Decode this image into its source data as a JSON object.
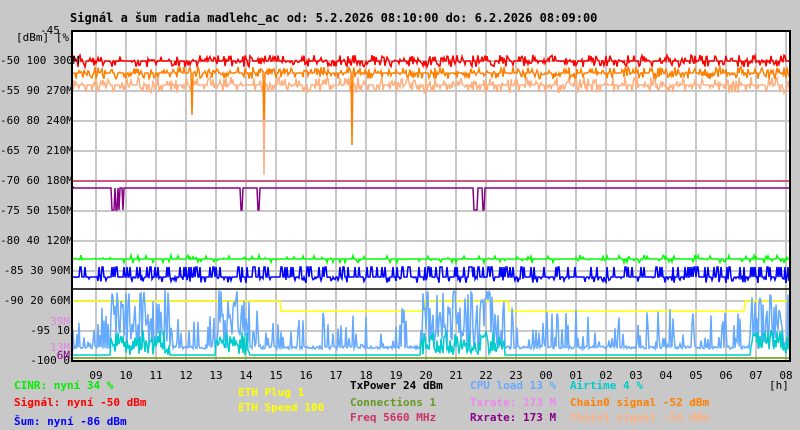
{
  "title": "Signál a šum radia madlehc_ac od: 5.2.2026 08:10:00 do: 6.2.2026 08:09:00",
  "chart_data": {
    "type": "line",
    "title": "Signál a šum radia madlehc_ac od: 5.2.2026 08:10:00 do: 6.2.2026 08:09:00",
    "xlabel": "[h]",
    "ylabel_units": "[dBm] [%]",
    "ylim_dbm": [
      -100,
      -45
    ],
    "ylim_pct": [
      0,
      100
    ],
    "ylim_rate_M": [
      0,
      300
    ],
    "grid": true,
    "y_ticks": [
      {
        "dbm": "-45",
        "pct": "",
        "rate": ""
      },
      {
        "dbm": "-50",
        "pct": "100",
        "rate": "300M"
      },
      {
        "dbm": "-55",
        "pct": "90",
        "rate": "270M"
      },
      {
        "dbm": "-60",
        "pct": "80",
        "rate": "240M"
      },
      {
        "dbm": "-65",
        "pct": "70",
        "rate": "210M"
      },
      {
        "dbm": "-70",
        "pct": "60",
        "rate": "180M"
      },
      {
        "dbm": "-75",
        "pct": "50",
        "rate": "150M"
      },
      {
        "dbm": "-80",
        "pct": "40",
        "rate": "120M"
      },
      {
        "dbm": "-85",
        "pct": "30",
        "rate": "90M"
      },
      {
        "dbm": "-90",
        "pct": "20",
        "rate": "60M"
      },
      {
        "dbm": "-95",
        "pct": "10",
        "rate": ""
      },
      {
        "dbm": "-100",
        "pct": "0",
        "rate": ""
      }
    ],
    "extra_rate_ticks": [
      {
        "label": "39M",
        "value": 39,
        "color": "#dd88dd"
      },
      {
        "label": "13M",
        "value": 13,
        "color": "#dd88dd"
      },
      {
        "label": "6M",
        "value": 6,
        "color": "#880088"
      }
    ],
    "x_ticks": [
      "09",
      "10",
      "11",
      "12",
      "13",
      "14",
      "15",
      "16",
      "17",
      "18",
      "19",
      "20",
      "21",
      "22",
      "23",
      "00",
      "01",
      "02",
      "03",
      "04",
      "05",
      "06",
      "07",
      "08"
    ],
    "series": [
      {
        "name": "Signál",
        "scale": "dbm",
        "level": -50,
        "color": "#ff0000"
      },
      {
        "name": "Chain0 signal",
        "scale": "dbm",
        "level": -52,
        "color": "#ff8000"
      },
      {
        "name": "Chain1 signal",
        "scale": "dbm",
        "level": -54,
        "color": "#ffb080"
      },
      {
        "name": "Šum",
        "scale": "dbm",
        "level": -86,
        "color": "#0000ff"
      },
      {
        "name": "CINR",
        "scale": "pct",
        "level": 34,
        "color": "#00ff00"
      },
      {
        "name": "TxPower",
        "scale": "pct",
        "level": 24,
        "color": "#000000"
      },
      {
        "name": "Rxrate",
        "scale": "rate",
        "level": 173,
        "color": "#880088"
      },
      {
        "name": "Freq",
        "scale": "rate",
        "level": 180,
        "color": "#cc3366"
      },
      {
        "name": "ETH Speed",
        "scale": "rate",
        "level": 60,
        "level_low": 50,
        "color": "#ffff00"
      },
      {
        "name": "Connections",
        "scale": "pct",
        "level": 1,
        "color": "#669900"
      },
      {
        "name": "CPU load",
        "scale": "pct",
        "level": 4,
        "color": "#66aaff"
      },
      {
        "name": "Airtime",
        "scale": "pct",
        "level": 2,
        "color": "#00cccc"
      }
    ]
  },
  "legend": {
    "cinr": "CINR: nyní 34 %",
    "signal": "Signál: nyní -50 dBm",
    "noise": "Šum: nyní -86 dBm",
    "eth_plug": "ETH Plug 1",
    "eth_speed": "ETH Speed 100",
    "txpower": "TxPower 24 dBm",
    "connections": "Connections 1",
    "freq": "Freq 5660 MHz",
    "cpu": "CPU load 13 %",
    "txrate": "Txrate: 173 M",
    "rxrate": "Rxrate: 173 M",
    "airtime": "Airtime 4 %",
    "chain0": "Chain0 signal -52 dBm",
    "chain1": "Chain1 signal -54 dBm",
    "hours_unit": "[h]"
  }
}
